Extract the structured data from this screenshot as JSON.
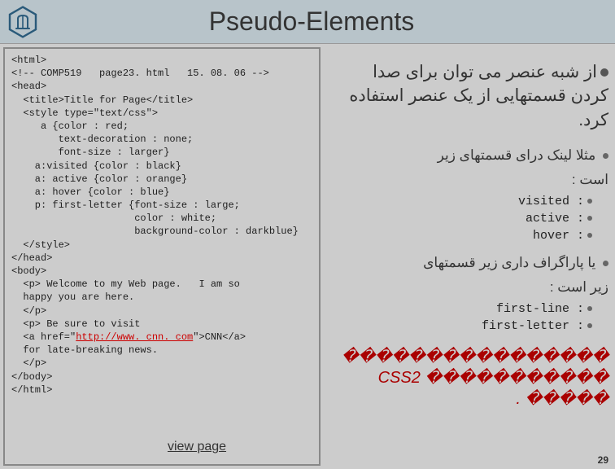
{
  "title": "Pseudo-Elements",
  "code": {
    "l1": "<html>",
    "l2": "<!-- COMP519   page23. html   15. 08. 06 -->",
    "l3": "",
    "l4": "<head>",
    "l5": "  <title>Title for Page</title>",
    "l6": "  <style type=\"text/css\">",
    "l7": "     a {color : red;",
    "l8": "        text-decoration : none;",
    "l9": "        font-size : larger}",
    "l10": "    a:visited {color : black}",
    "l11": "    a: active {color : orange}",
    "l12": "    a: hover {color : blue}",
    "l13": "    p: first-letter {font-size : large;",
    "l14": "                     color : white;",
    "l15": "                     background-color : darkblue}",
    "l16": "  </style>",
    "l17": "</head>",
    "l18": "",
    "l19": "<body>",
    "l20": "  <p> Welcome to my Web page.   I am so",
    "l21": "  happy you are here.",
    "l22": "  </p>",
    "l23": "  <p> Be sure to visit",
    "l24a": "  <a href=\"",
    "l24url": "http://www. cnn. com",
    "l24b": "\">CNN</a>",
    "l25": "  for late-breaking news.",
    "l26": "  </p>",
    "l27": "</body>",
    "l28": "</html>"
  },
  "view_page": "view page",
  "right": {
    "main1": "از شبه عنصر می توان برای صدا کردن قسمتهایی از یک عنصر استفاده کرد.",
    "sub1": "مثلا لینک درای قسمتهای زیر",
    "sub1b": "است :",
    "codes1": [
      ": visited",
      ": active",
      ": hover"
    ],
    "sub2": "یا پاراگراف داری زیر قسمتهای",
    "sub2b": "زیر است :",
    "codes2": [
      ": first-line",
      ": first-letter"
    ],
    "note1": "����������������",
    "note2": "����������� CSS2",
    "note3": "����� ."
  },
  "page_num": "29"
}
